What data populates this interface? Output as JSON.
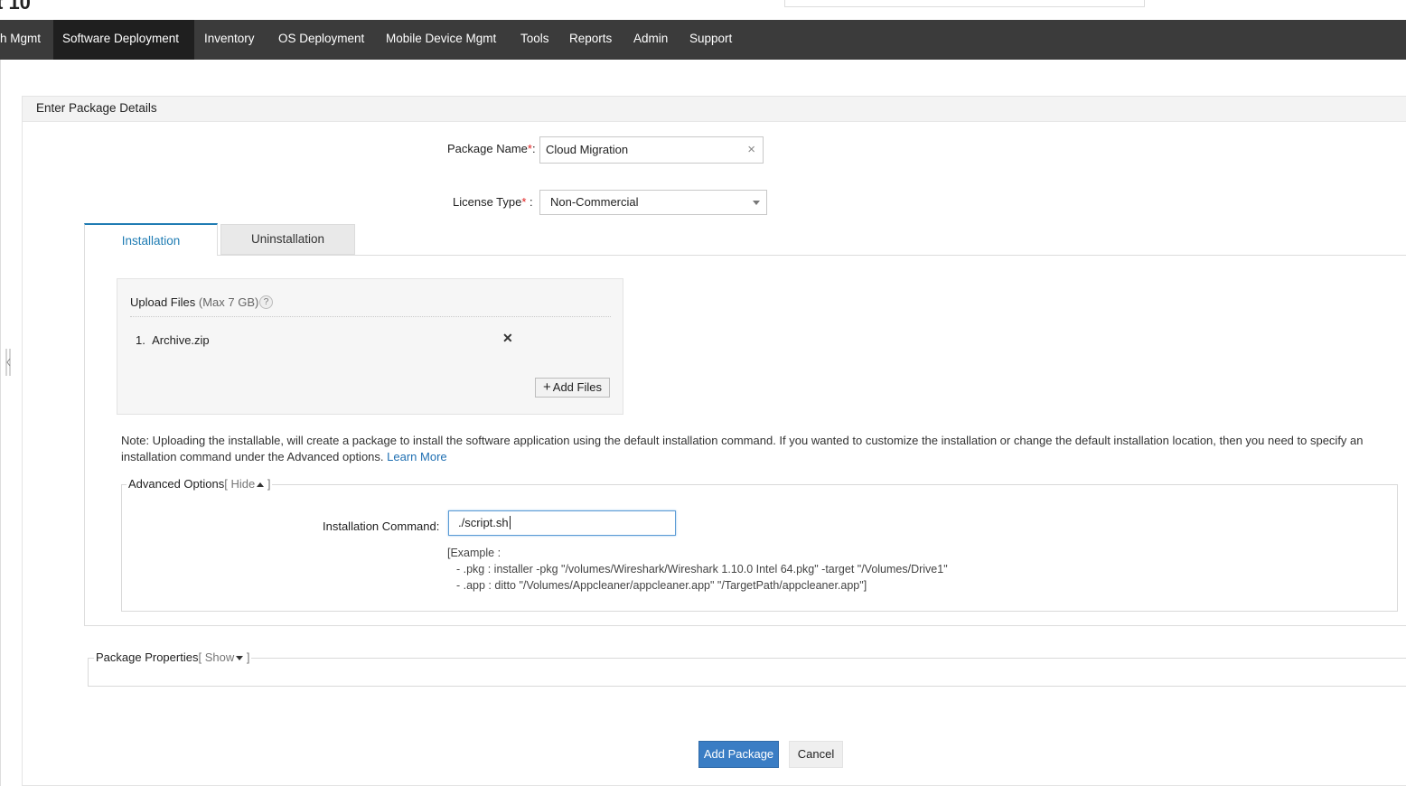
{
  "header": {
    "title_fragment": "t 10"
  },
  "nav": {
    "items": [
      {
        "label": "h Mgmt",
        "active": false
      },
      {
        "label": "Software Deployment",
        "active": true
      },
      {
        "label": "Inventory",
        "active": false
      },
      {
        "label": "OS Deployment",
        "active": false
      },
      {
        "label": "Mobile Device Mgmt",
        "active": false
      },
      {
        "label": "Tools",
        "active": false
      },
      {
        "label": "Reports",
        "active": false
      },
      {
        "label": "Admin",
        "active": false
      },
      {
        "label": "Support",
        "active": false
      }
    ]
  },
  "panel": {
    "title": "Enter Package Details"
  },
  "form": {
    "package_name_label": "Package Name",
    "package_name_suffix": ":",
    "package_name_value": "Cloud Migration",
    "license_type_label": "License Type",
    "license_type_suffix": " :",
    "license_type_value": "Non-Commercial",
    "required_mark": "*"
  },
  "tabs": [
    {
      "label": "Installation",
      "active": true
    },
    {
      "label": "Uninstallation",
      "active": false
    }
  ],
  "upload": {
    "title": "Upload Files",
    "max": "(Max 7 GB)",
    "help": "?",
    "files": [
      {
        "index": "1.",
        "name": "Archive.zip"
      }
    ],
    "add_files_label": "Add Files"
  },
  "note": {
    "text": "Note: Uploading the installable, will create a package to install the software application using the default installation command. If you wanted to customize the installation or change the default installation location, then you need to specify an installation command under the Advanced options.",
    "link_text": "Learn More"
  },
  "advanced": {
    "legend": "Advanced Options",
    "toggle_open": "[ ",
    "toggle_label": "Hide",
    "toggle_close": " ]",
    "command_label": "Installation Command:",
    "command_value": "./script.sh",
    "example_heading": "[Example :",
    "example_lines": [
      "- .pkg : installer -pkg \"/volumes/Wireshark/Wireshark 1.10.0 Intel 64.pkg\" -target \"/Volumes/Drive1\"",
      "- .app : ditto \"/Volumes/Appcleaner/appcleaner.app\" \"/TargetPath/appcleaner.app\"]"
    ]
  },
  "properties": {
    "legend": "Package Properties",
    "toggle_open": "[ ",
    "toggle_label": "Show",
    "toggle_close": " ]"
  },
  "actions": {
    "add_package": "Add Package",
    "cancel": "Cancel"
  },
  "colors": {
    "nav_bg": "#3b3b3b",
    "nav_active": "#1f1f1f",
    "accent": "#1f7cb3",
    "primary_button": "#3a7dc4",
    "required": "#e02020"
  }
}
